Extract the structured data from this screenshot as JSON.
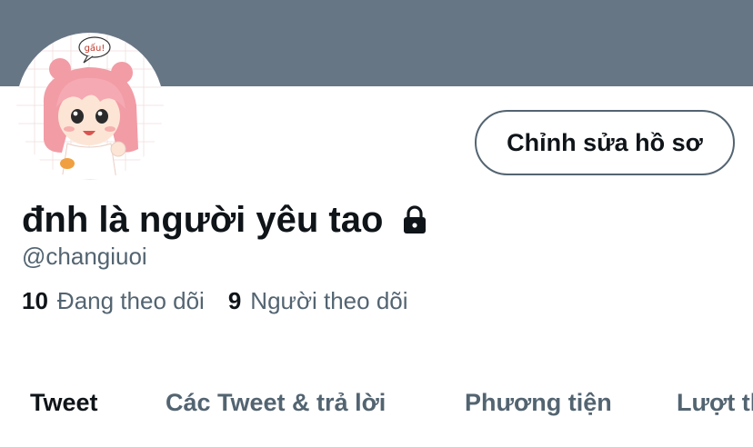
{
  "colors": {
    "banner": "#677685",
    "primary_text": "#0f1419",
    "secondary_text": "#536471",
    "avatar_hair": "#f29ca6"
  },
  "profile": {
    "display_name": "đnh là người yêu tao",
    "handle": "@changiuoi",
    "protected_icon": "lock-icon",
    "avatar_icon": "avatar-chibi-pink-hair",
    "avatar_bubble_text": "gấu!"
  },
  "actions": {
    "edit_profile_label": "Chỉnh sửa hồ sơ"
  },
  "stats": {
    "following_count": "10",
    "following_label": "Đang theo dõi",
    "followers_count": "9",
    "followers_label": "Người theo dõi"
  },
  "tabs": [
    {
      "label": "Tweet",
      "active": true
    },
    {
      "label": "Các Tweet & trả lời",
      "active": false
    },
    {
      "label": "Phương tiện",
      "active": false
    },
    {
      "label": "Lượt thích",
      "active": false
    }
  ]
}
